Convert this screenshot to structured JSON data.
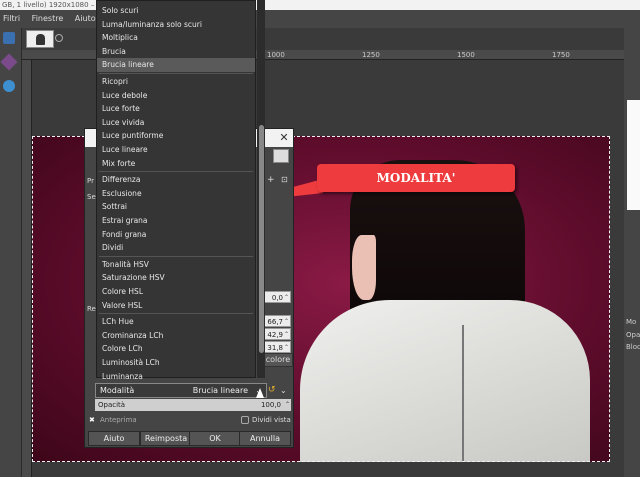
{
  "window": {
    "title": "GB, 1 livello) 1920x1080 – GIMP"
  },
  "menubar": {
    "items": [
      "Filtri",
      "Finestre",
      "Aiuto"
    ]
  },
  "ruler": {
    "ticks": [
      "1000",
      "1250",
      "1500",
      "1750"
    ]
  },
  "dialog": {
    "side_labels": {
      "pr": "Pr",
      "se": "Se",
      "re": "Re"
    },
    "spin_values": [
      "0,0",
      "66,7",
      "42,9",
      "31,8",
      "100,0"
    ],
    "color_button": "colore",
    "modality_label": "Modalità",
    "modality_value": "Brucia lineare",
    "opacity_label": "Opacità",
    "opacity_value": "100,0",
    "preview_label": "Anteprima",
    "split_view_label": "Dividi vista",
    "buttons": {
      "help": "Aiuto",
      "reset": "Reimposta",
      "ok": "OK",
      "cancel": "Annulla"
    }
  },
  "blend_menu": {
    "selected": "Brucia lineare",
    "groups": [
      [
        "Solo scuri",
        "Luma/luminanza solo scuri",
        "Moltiplica",
        "Brucia",
        "Brucia lineare"
      ],
      [
        "Ricopri",
        "Luce debole",
        "Luce forte",
        "Luce vivida",
        "Luce puntiforme",
        "Luce lineare",
        "Mix forte"
      ],
      [
        "Differenza",
        "Esclusione",
        "Sottrai",
        "Estrai grana",
        "Fondi grana",
        "Dividi"
      ],
      [
        "Tonalità HSV",
        "Saturazione HSV",
        "Colore HSL",
        "Valore HSL"
      ],
      [
        "LCh Hue",
        "Crominanza LCh",
        "Colore LCh",
        "Luminosità LCh",
        "Luminanza"
      ]
    ]
  },
  "callout": {
    "text": "MODALITA'",
    "color": "#ee3b3e"
  },
  "right_dock": {
    "labels": [
      "Mo",
      "Opac",
      "Blocc"
    ]
  }
}
